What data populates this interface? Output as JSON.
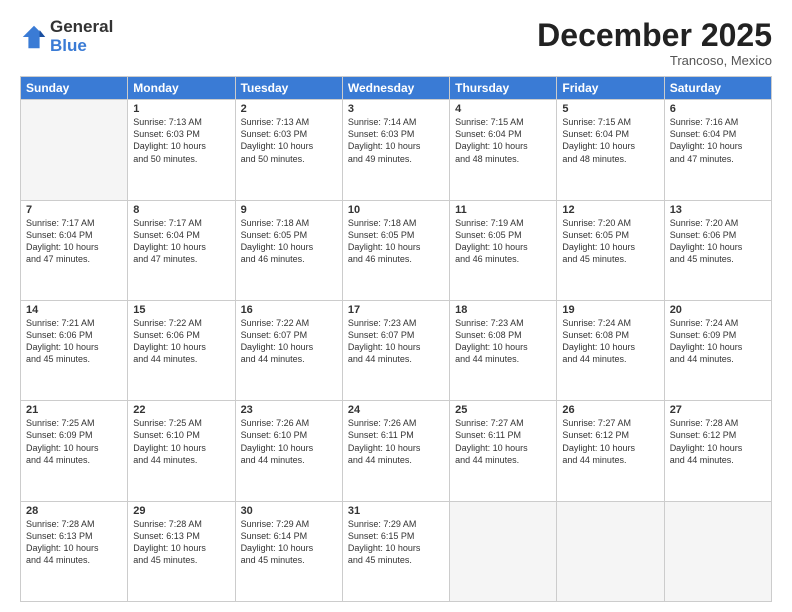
{
  "logo": {
    "general": "General",
    "blue": "Blue"
  },
  "title": "December 2025",
  "subtitle": "Trancoso, Mexico",
  "days_of_week": [
    "Sunday",
    "Monday",
    "Tuesday",
    "Wednesday",
    "Thursday",
    "Friday",
    "Saturday"
  ],
  "weeks": [
    [
      {
        "day": "",
        "info": ""
      },
      {
        "day": "1",
        "info": "Sunrise: 7:13 AM\nSunset: 6:03 PM\nDaylight: 10 hours\nand 50 minutes."
      },
      {
        "day": "2",
        "info": "Sunrise: 7:13 AM\nSunset: 6:03 PM\nDaylight: 10 hours\nand 50 minutes."
      },
      {
        "day": "3",
        "info": "Sunrise: 7:14 AM\nSunset: 6:03 PM\nDaylight: 10 hours\nand 49 minutes."
      },
      {
        "day": "4",
        "info": "Sunrise: 7:15 AM\nSunset: 6:04 PM\nDaylight: 10 hours\nand 48 minutes."
      },
      {
        "day": "5",
        "info": "Sunrise: 7:15 AM\nSunset: 6:04 PM\nDaylight: 10 hours\nand 48 minutes."
      },
      {
        "day": "6",
        "info": "Sunrise: 7:16 AM\nSunset: 6:04 PM\nDaylight: 10 hours\nand 47 minutes."
      }
    ],
    [
      {
        "day": "7",
        "info": "Sunrise: 7:17 AM\nSunset: 6:04 PM\nDaylight: 10 hours\nand 47 minutes."
      },
      {
        "day": "8",
        "info": "Sunrise: 7:17 AM\nSunset: 6:04 PM\nDaylight: 10 hours\nand 47 minutes."
      },
      {
        "day": "9",
        "info": "Sunrise: 7:18 AM\nSunset: 6:05 PM\nDaylight: 10 hours\nand 46 minutes."
      },
      {
        "day": "10",
        "info": "Sunrise: 7:18 AM\nSunset: 6:05 PM\nDaylight: 10 hours\nand 46 minutes."
      },
      {
        "day": "11",
        "info": "Sunrise: 7:19 AM\nSunset: 6:05 PM\nDaylight: 10 hours\nand 46 minutes."
      },
      {
        "day": "12",
        "info": "Sunrise: 7:20 AM\nSunset: 6:05 PM\nDaylight: 10 hours\nand 45 minutes."
      },
      {
        "day": "13",
        "info": "Sunrise: 7:20 AM\nSunset: 6:06 PM\nDaylight: 10 hours\nand 45 minutes."
      }
    ],
    [
      {
        "day": "14",
        "info": "Sunrise: 7:21 AM\nSunset: 6:06 PM\nDaylight: 10 hours\nand 45 minutes."
      },
      {
        "day": "15",
        "info": "Sunrise: 7:22 AM\nSunset: 6:06 PM\nDaylight: 10 hours\nand 44 minutes."
      },
      {
        "day": "16",
        "info": "Sunrise: 7:22 AM\nSunset: 6:07 PM\nDaylight: 10 hours\nand 44 minutes."
      },
      {
        "day": "17",
        "info": "Sunrise: 7:23 AM\nSunset: 6:07 PM\nDaylight: 10 hours\nand 44 minutes."
      },
      {
        "day": "18",
        "info": "Sunrise: 7:23 AM\nSunset: 6:08 PM\nDaylight: 10 hours\nand 44 minutes."
      },
      {
        "day": "19",
        "info": "Sunrise: 7:24 AM\nSunset: 6:08 PM\nDaylight: 10 hours\nand 44 minutes."
      },
      {
        "day": "20",
        "info": "Sunrise: 7:24 AM\nSunset: 6:09 PM\nDaylight: 10 hours\nand 44 minutes."
      }
    ],
    [
      {
        "day": "21",
        "info": "Sunrise: 7:25 AM\nSunset: 6:09 PM\nDaylight: 10 hours\nand 44 minutes."
      },
      {
        "day": "22",
        "info": "Sunrise: 7:25 AM\nSunset: 6:10 PM\nDaylight: 10 hours\nand 44 minutes."
      },
      {
        "day": "23",
        "info": "Sunrise: 7:26 AM\nSunset: 6:10 PM\nDaylight: 10 hours\nand 44 minutes."
      },
      {
        "day": "24",
        "info": "Sunrise: 7:26 AM\nSunset: 6:11 PM\nDaylight: 10 hours\nand 44 minutes."
      },
      {
        "day": "25",
        "info": "Sunrise: 7:27 AM\nSunset: 6:11 PM\nDaylight: 10 hours\nand 44 minutes."
      },
      {
        "day": "26",
        "info": "Sunrise: 7:27 AM\nSunset: 6:12 PM\nDaylight: 10 hours\nand 44 minutes."
      },
      {
        "day": "27",
        "info": "Sunrise: 7:28 AM\nSunset: 6:12 PM\nDaylight: 10 hours\nand 44 minutes."
      }
    ],
    [
      {
        "day": "28",
        "info": "Sunrise: 7:28 AM\nSunset: 6:13 PM\nDaylight: 10 hours\nand 44 minutes."
      },
      {
        "day": "29",
        "info": "Sunrise: 7:28 AM\nSunset: 6:13 PM\nDaylight: 10 hours\nand 45 minutes."
      },
      {
        "day": "30",
        "info": "Sunrise: 7:29 AM\nSunset: 6:14 PM\nDaylight: 10 hours\nand 45 minutes."
      },
      {
        "day": "31",
        "info": "Sunrise: 7:29 AM\nSunset: 6:15 PM\nDaylight: 10 hours\nand 45 minutes."
      },
      {
        "day": "",
        "info": ""
      },
      {
        "day": "",
        "info": ""
      },
      {
        "day": "",
        "info": ""
      }
    ]
  ]
}
